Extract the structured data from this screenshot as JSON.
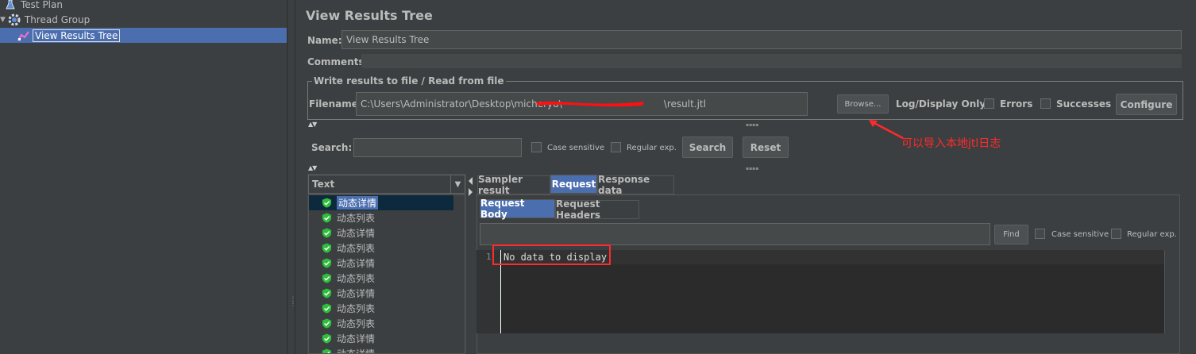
{
  "tree": {
    "items": [
      {
        "label": "Test Plan",
        "icon": "flask-icon"
      },
      {
        "label": "Thread Group",
        "icon": "gear-icon"
      },
      {
        "label": "View Results Tree",
        "icon": "chart-icon"
      }
    ]
  },
  "panel": {
    "title": "View Results Tree",
    "name_label": "Name:",
    "name_value": "View Results Tree",
    "comments_label": "Comments:"
  },
  "file_section": {
    "title": "Write results to file / Read from file",
    "filename_label": "Filename",
    "filename_value_prefix": "C:\\Users\\Administrator\\Desktop\\micheryu\\",
    "filename_value_suffix": "\\result.jtl",
    "browse_label": "Browse...",
    "log_display_label": "Log/Display Only:",
    "errors_label": "Errors",
    "successes_label": "Successes",
    "configure_label": "Configure"
  },
  "annotation": {
    "text": "可以导入本地jtl日志",
    "color": "#ff2a2a"
  },
  "search_bar": {
    "label": "Search:",
    "value": "",
    "case_sensitive_label": "Case sensitive",
    "regex_label": "Regular exp.",
    "search_button": "Search",
    "reset_button": "Reset"
  },
  "results": {
    "renderer": "Text",
    "items": [
      {
        "label": "动态详情",
        "status": "success",
        "selected": true
      },
      {
        "label": "动态列表",
        "status": "success"
      },
      {
        "label": "动态详情",
        "status": "success"
      },
      {
        "label": "动态列表",
        "status": "success"
      },
      {
        "label": "动态详情",
        "status": "success"
      },
      {
        "label": "动态列表",
        "status": "success"
      },
      {
        "label": "动态详情",
        "status": "success"
      },
      {
        "label": "动态列表",
        "status": "success"
      },
      {
        "label": "动态列表",
        "status": "success"
      },
      {
        "label": "动态详情",
        "status": "success"
      },
      {
        "label": "动态详情",
        "status": "success"
      }
    ]
  },
  "tabs": {
    "main": [
      {
        "label": "Sampler result",
        "active": false
      },
      {
        "label": "Request",
        "active": true
      },
      {
        "label": "Response data",
        "active": false
      }
    ],
    "sub": [
      {
        "label": "Request Body",
        "active": true
      },
      {
        "label": "Request Headers",
        "active": false
      }
    ]
  },
  "find_bar": {
    "value": "",
    "find_button": "Find",
    "case_sensitive_label": "Case sensitive",
    "regex_label": "Regular exp."
  },
  "editor": {
    "line_number": "1",
    "text": "No data to display"
  },
  "colors": {
    "background": "#3c3f41",
    "selection": "#4b6eaf",
    "success": "#2dbf3a",
    "annotation": "#ff2a2a"
  }
}
